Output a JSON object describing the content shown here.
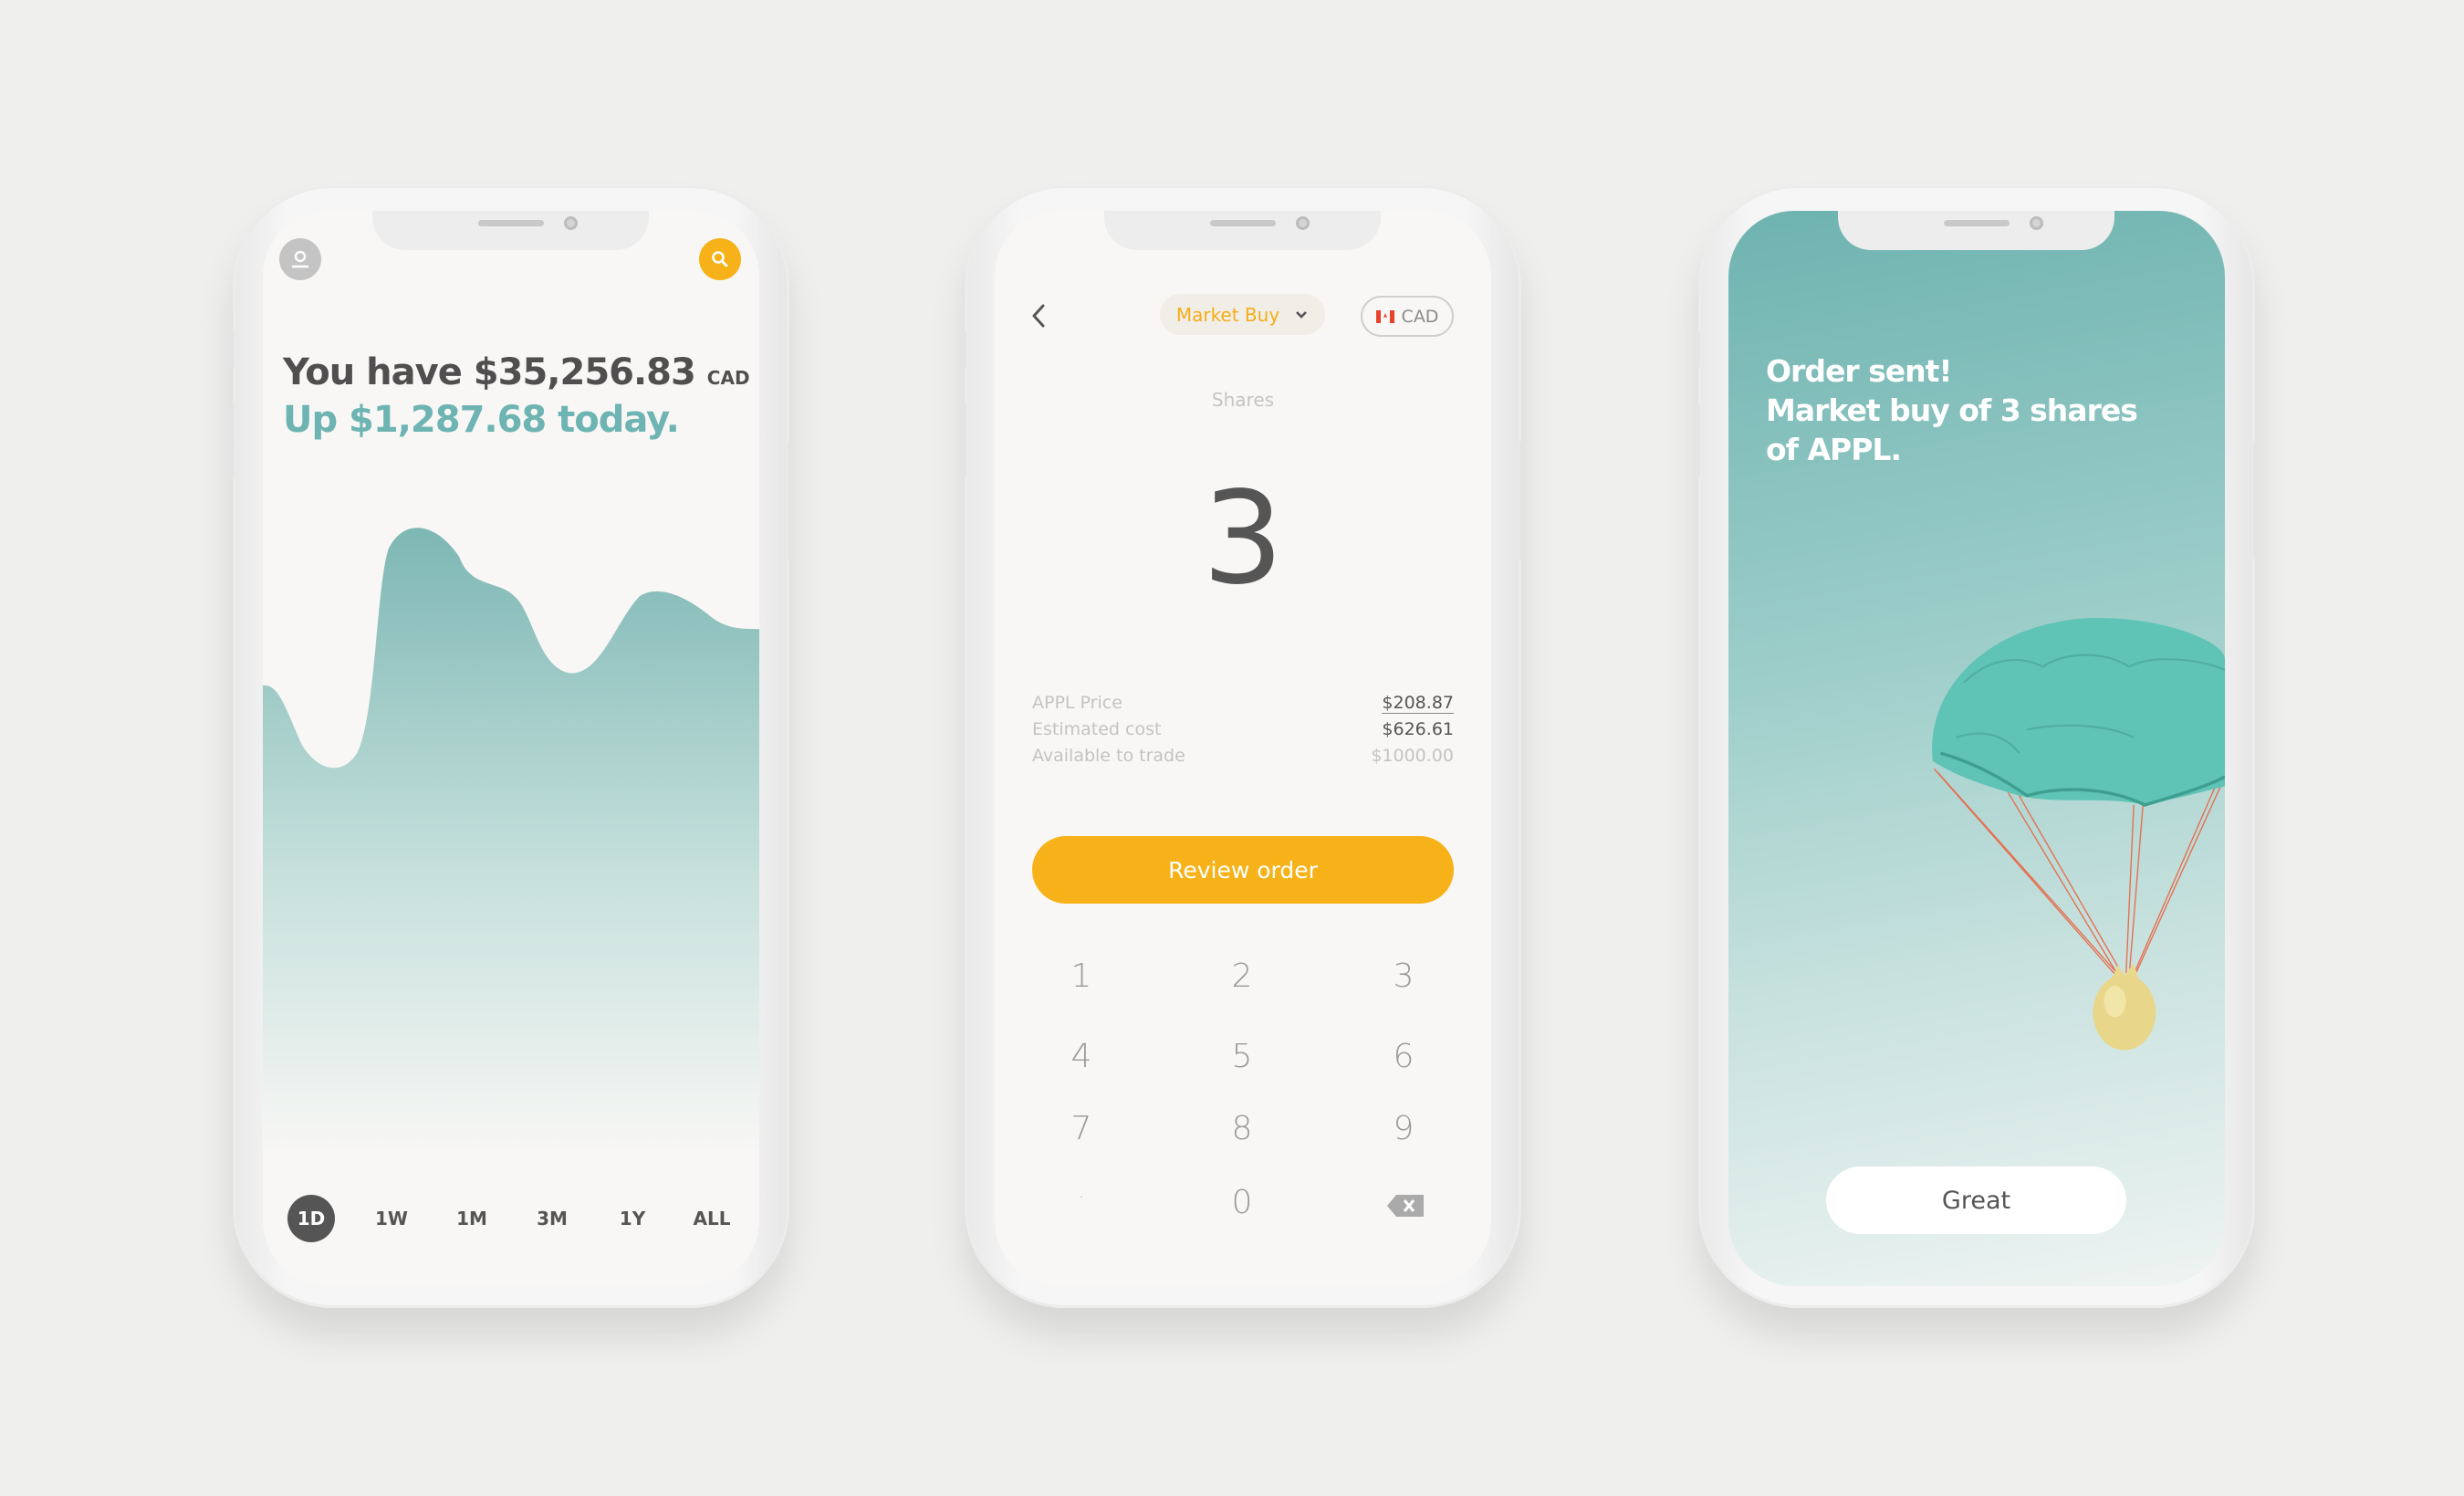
{
  "colors": {
    "background": "#efefed",
    "accent_yellow": "#f8b219",
    "teal": "#6db4b3",
    "dark_text": "#504e4e"
  },
  "portfolio": {
    "avatar_icon": "user-icon",
    "search_icon": "search-icon",
    "balance_prefix": "You have",
    "balance": "$35,256.83",
    "currency": "CAD",
    "change_text": "Up $1,287.68 today.",
    "timeframes": [
      {
        "label": "1D",
        "active": true
      },
      {
        "label": "1W"
      },
      {
        "label": "1M"
      },
      {
        "label": "3M"
      },
      {
        "label": "1Y"
      },
      {
        "label": "ALL"
      }
    ]
  },
  "order": {
    "back_icon": "chevron-left-icon",
    "order_type": "Market Buy",
    "currency": "CAD",
    "flag_icon": "canada-flag-icon",
    "shares_label": "Shares",
    "shares_value": "3",
    "details": [
      {
        "label": "APPL Price",
        "value": "$208.87"
      },
      {
        "label": "Estimated cost",
        "value": "$626.61"
      },
      {
        "label": "Available to trade",
        "value": "$1000.00"
      }
    ],
    "review_button": "Review order",
    "keypad": [
      "1",
      "2",
      "3",
      "4",
      "5",
      "6",
      "7",
      "8",
      "9",
      ".",
      "0",
      "backspace"
    ]
  },
  "confirmation": {
    "line1": "Order sent!",
    "line2": "Market buy of 3 shares",
    "line3": "of APPL.",
    "illustration": "parachute-money-bag",
    "button": "Great"
  }
}
